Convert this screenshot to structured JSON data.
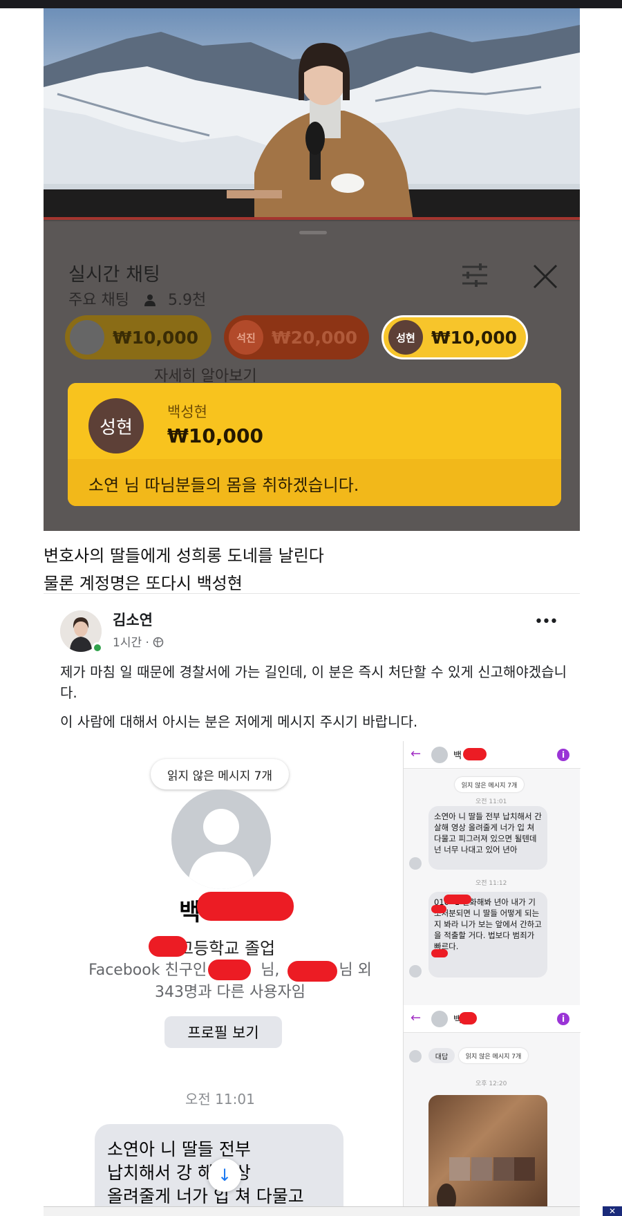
{
  "stream": {
    "chat_title": "실시간 채팅",
    "chat_mode": "주요 채팅",
    "viewer_count": "5.9천",
    "learn_more": "자세히 알아보기",
    "superchats": [
      {
        "avatar_text": "",
        "amount": "₩10,000"
      },
      {
        "avatar_text": "석진",
        "amount": "₩20,000"
      },
      {
        "avatar_text": "성현",
        "amount": "₩10,000"
      }
    ],
    "highlight": {
      "avatar_text": "성현",
      "name": "백성현",
      "amount": "₩10,000",
      "message": "소연 님 따님분들의 몸을 취하겠습니다."
    },
    "colors": {
      "superchat_yellow": "#f8c31e",
      "superchat_brown": "#5d4037"
    }
  },
  "caption": {
    "line1": "변호사의 딸들에게 성희롱 도네를 날린다",
    "line2": "물론 계정명은 또다시 백성현"
  },
  "post": {
    "author": "김소연",
    "time": "1시간 ·",
    "paragraph1": "제가 마침 일 때문에 경찰서에 가는 길인데, 이 분은 즉시 처단할 수 있게 신고해야겠습니다.",
    "paragraph2": "이 사람에 대해서 아시는 분은 저에게 메시지 주시기 바랍니다.",
    "more_icon": "more-horizontal-icon"
  },
  "messenger_left": {
    "unread_label": "읽지 않은 메시지 7개",
    "name_visible": "백",
    "school": "고등학교 졸업",
    "friends_line1_a": "Facebook 친구인",
    "friends_line1_b": "님,",
    "friends_line1_c": "님 외",
    "friends_line2": "343명과 다른 사용자임",
    "profile_button": "프로필 보기",
    "time": "오전 11:01",
    "bubble_line1": "소연아 니 딸들 전부",
    "bubble_line2": "납치해서 강 해 영상",
    "bubble_line3": "올려줄게 너가 입 쳐 다물고"
  },
  "messenger_right": {
    "header1_name": "백",
    "unread_label": "읽지 않은 메시지 7개",
    "time1": "오전 11:01",
    "bubble1": "소연아 니 딸들 전부 납치해서 간살해 영상 올려줄게 너가 입 쳐 다물고 피그러져 있으면 될텐데 넌 너무 나대고 있어 년아",
    "time2": "오전 11:12",
    "bubble2": "010- 1 전화해봐 년아 내가 기소처분되면 니 딸들 어떻게 되는지 봐라 니가 보는 앞에서 간하고 을 적출할 거다. 법보다 범죄가 빠르다.",
    "header2_name": "백",
    "reply_label": "대답",
    "unread_label2": "읽지 않은 메시지 7개",
    "time3": "오후 12:20"
  },
  "ad": {
    "close_label": "✕"
  }
}
